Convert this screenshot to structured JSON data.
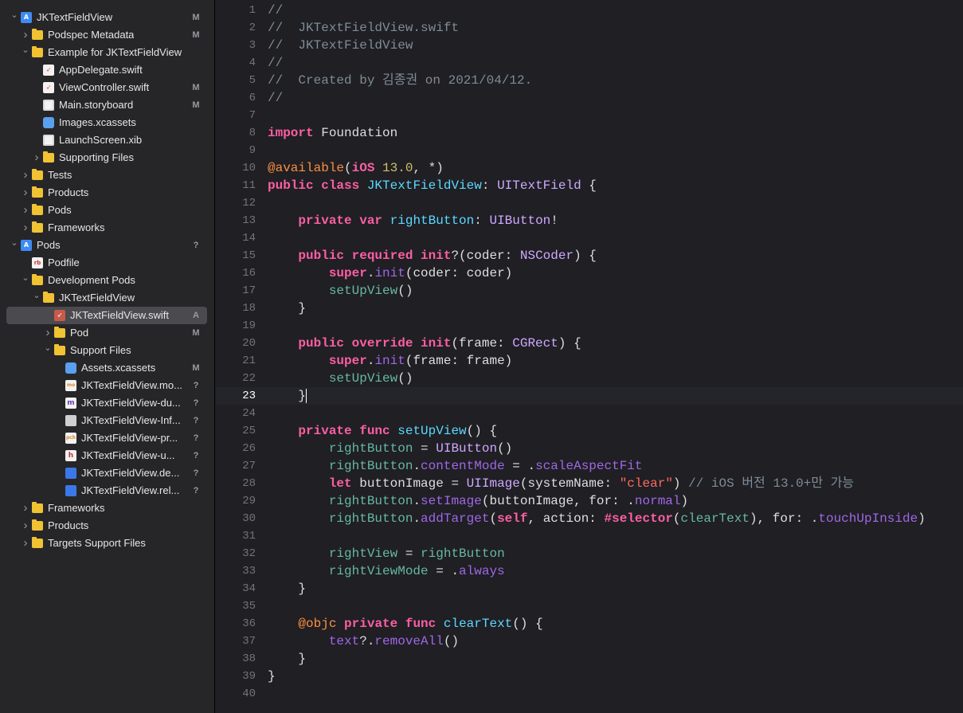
{
  "navigator": {
    "rows": [
      {
        "label": "JKTextFieldView",
        "status": "M",
        "indent": 0,
        "chevron": "down",
        "icon": "project",
        "iconGlyph": "A",
        "name": "project-jktextfieldview"
      },
      {
        "label": "Podspec Metadata",
        "status": "M",
        "indent": 1,
        "chevron": "right",
        "icon": "folder",
        "name": "folder-podspec-metadata"
      },
      {
        "label": "Example for JKTextFieldView",
        "status": "",
        "indent": 1,
        "chevron": "down",
        "icon": "folder",
        "name": "folder-example"
      },
      {
        "label": "AppDelegate.swift",
        "status": "",
        "indent": 2,
        "chevron": "",
        "icon": "swift",
        "iconGlyph": "➶",
        "name": "file-appdelegate"
      },
      {
        "label": "ViewController.swift",
        "status": "M",
        "indent": 2,
        "chevron": "",
        "icon": "swift",
        "iconGlyph": "➶",
        "name": "file-viewcontroller"
      },
      {
        "label": "Main.storyboard",
        "status": "M",
        "indent": 2,
        "chevron": "",
        "icon": "storyboard",
        "name": "file-main-storyboard"
      },
      {
        "label": "Images.xcassets",
        "status": "",
        "indent": 2,
        "chevron": "",
        "icon": "assets",
        "name": "file-images-xcassets"
      },
      {
        "label": "LaunchScreen.xib",
        "status": "",
        "indent": 2,
        "chevron": "",
        "icon": "xib",
        "name": "file-launchscreen-xib"
      },
      {
        "label": "Supporting Files",
        "status": "",
        "indent": 2,
        "chevron": "right",
        "icon": "folder",
        "name": "folder-supporting-files"
      },
      {
        "label": "Tests",
        "status": "",
        "indent": 1,
        "chevron": "right",
        "icon": "folder",
        "name": "folder-tests"
      },
      {
        "label": "Products",
        "status": "",
        "indent": 1,
        "chevron": "right",
        "icon": "folder",
        "name": "folder-products"
      },
      {
        "label": "Pods",
        "status": "",
        "indent": 1,
        "chevron": "right",
        "icon": "folder",
        "name": "folder-pods"
      },
      {
        "label": "Frameworks",
        "status": "",
        "indent": 1,
        "chevron": "right",
        "icon": "folder",
        "name": "folder-frameworks"
      },
      {
        "label": "Pods",
        "status": "?",
        "indent": 0,
        "chevron": "down",
        "icon": "project",
        "iconGlyph": "A",
        "name": "project-pods"
      },
      {
        "label": "Podfile",
        "status": "",
        "indent": 1,
        "chevron": "",
        "icon": "rb",
        "iconGlyph": "rb",
        "name": "file-podfile"
      },
      {
        "label": "Development Pods",
        "status": "",
        "indent": 1,
        "chevron": "down",
        "icon": "folder",
        "name": "folder-development-pods"
      },
      {
        "label": "JKTextFieldView",
        "status": "",
        "indent": 2,
        "chevron": "down",
        "icon": "folder",
        "name": "folder-jktextfieldview"
      },
      {
        "label": "JKTextFieldView.swift",
        "status": "A",
        "indent": 3,
        "chevron": "",
        "icon": "swift-sel",
        "iconGlyph": "➶",
        "selected": true,
        "name": "file-jktextfieldview-swift"
      },
      {
        "label": "Pod",
        "status": "M",
        "indent": 3,
        "chevron": "right",
        "icon": "folder",
        "name": "folder-pod"
      },
      {
        "label": "Support Files",
        "status": "",
        "indent": 3,
        "chevron": "down",
        "icon": "folder",
        "name": "folder-support-files"
      },
      {
        "label": "Assets.xcassets",
        "status": "M",
        "indent": 4,
        "chevron": "",
        "icon": "assets",
        "name": "file-assets-xcassets"
      },
      {
        "label": "JKTextFieldView.mo...",
        "status": "?",
        "indent": 4,
        "chevron": "",
        "icon": "pch",
        "iconGlyph": "mo",
        "name": "file-modulemap"
      },
      {
        "label": "JKTextFieldView-du...",
        "status": "?",
        "indent": 4,
        "chevron": "",
        "icon": "m",
        "iconGlyph": "m",
        "name": "file-dummy-m"
      },
      {
        "label": "JKTextFieldView-Inf...",
        "status": "?",
        "indent": 4,
        "chevron": "",
        "icon": "doc",
        "name": "file-info-plist"
      },
      {
        "label": "JKTextFieldView-pr...",
        "status": "?",
        "indent": 4,
        "chevron": "",
        "icon": "pch",
        "iconGlyph": "pch",
        "name": "file-prefix-pch"
      },
      {
        "label": "JKTextFieldView-u...",
        "status": "?",
        "indent": 4,
        "chevron": "",
        "icon": "h",
        "iconGlyph": "h",
        "name": "file-umbrella-h"
      },
      {
        "label": "JKTextFieldView.de...",
        "status": "?",
        "indent": 4,
        "chevron": "",
        "icon": "blue",
        "name": "file-debug-xcconfig"
      },
      {
        "label": "JKTextFieldView.rel...",
        "status": "?",
        "indent": 4,
        "chevron": "",
        "icon": "blue",
        "name": "file-release-xcconfig"
      },
      {
        "label": "Frameworks",
        "status": "",
        "indent": 1,
        "chevron": "right",
        "icon": "folder",
        "name": "folder-frameworks-2"
      },
      {
        "label": "Products",
        "status": "",
        "indent": 1,
        "chevron": "right",
        "icon": "folder",
        "name": "folder-products-2"
      },
      {
        "label": "Targets Support Files",
        "status": "",
        "indent": 1,
        "chevron": "right",
        "icon": "folder",
        "name": "folder-targets-support-files"
      }
    ]
  },
  "editor": {
    "active_line": 23,
    "lines": [
      [
        [
          "c",
          "//"
        ]
      ],
      [
        [
          "c",
          "//  JKTextFieldView.swift"
        ]
      ],
      [
        [
          "c",
          "//  JKTextFieldView"
        ]
      ],
      [
        [
          "c",
          "//"
        ]
      ],
      [
        [
          "c",
          "//  Created by 김종권 on 2021/04/12."
        ]
      ],
      [
        [
          "c",
          "//"
        ]
      ],
      [],
      [
        [
          "k",
          "import"
        ],
        [
          "p",
          " Foundation"
        ]
      ],
      [],
      [
        [
          "a",
          "@available"
        ],
        [
          "p",
          "("
        ],
        [
          "k",
          "iOS"
        ],
        [
          "p",
          " "
        ],
        [
          "n",
          "13.0"
        ],
        [
          "p",
          ", *)"
        ]
      ],
      [
        [
          "k",
          "public class"
        ],
        [
          "p",
          " "
        ],
        [
          "d",
          "JKTextFieldView"
        ],
        [
          "p",
          ": "
        ],
        [
          "t",
          "UITextField"
        ],
        [
          "p",
          " {"
        ]
      ],
      [],
      [
        [
          "p",
          "    "
        ],
        [
          "k",
          "private var"
        ],
        [
          "p",
          " "
        ],
        [
          "d",
          "rightButton"
        ],
        [
          "p",
          ": "
        ],
        [
          "t",
          "UIButton"
        ],
        [
          "p",
          "!"
        ]
      ],
      [],
      [
        [
          "p",
          "    "
        ],
        [
          "k",
          "public required init"
        ],
        [
          "p",
          "?(coder: "
        ],
        [
          "t",
          "NSCoder"
        ],
        [
          "p",
          ") {"
        ]
      ],
      [
        [
          "p",
          "        "
        ],
        [
          "k",
          "super"
        ],
        [
          "p",
          "."
        ],
        [
          "m",
          "init"
        ],
        [
          "p",
          "(coder: coder)"
        ]
      ],
      [
        [
          "p",
          "        "
        ],
        [
          "r",
          "setUpView"
        ],
        [
          "p",
          "()"
        ]
      ],
      [
        [
          "p",
          "    }"
        ]
      ],
      [],
      [
        [
          "p",
          "    "
        ],
        [
          "k",
          "public override init"
        ],
        [
          "p",
          "(frame: "
        ],
        [
          "t",
          "CGRect"
        ],
        [
          "p",
          ") {"
        ]
      ],
      [
        [
          "p",
          "        "
        ],
        [
          "k",
          "super"
        ],
        [
          "p",
          "."
        ],
        [
          "m",
          "init"
        ],
        [
          "p",
          "(frame: frame)"
        ]
      ],
      [
        [
          "p",
          "        "
        ],
        [
          "r",
          "setUpView"
        ],
        [
          "p",
          "()"
        ]
      ],
      [
        [
          "p",
          "    }"
        ]
      ],
      [],
      [
        [
          "p",
          "    "
        ],
        [
          "k",
          "private func"
        ],
        [
          "p",
          " "
        ],
        [
          "d",
          "setUpView"
        ],
        [
          "p",
          "() {"
        ]
      ],
      [
        [
          "p",
          "        "
        ],
        [
          "r",
          "rightButton"
        ],
        [
          "p",
          " = "
        ],
        [
          "t",
          "UIButton"
        ],
        [
          "p",
          "()"
        ]
      ],
      [
        [
          "p",
          "        "
        ],
        [
          "r",
          "rightButton"
        ],
        [
          "p",
          "."
        ],
        [
          "m",
          "contentMode"
        ],
        [
          "p",
          " = ."
        ],
        [
          "m",
          "scaleAspectFit"
        ]
      ],
      [
        [
          "p",
          "        "
        ],
        [
          "k",
          "let"
        ],
        [
          "p",
          " buttonImage = "
        ],
        [
          "t",
          "UIImage"
        ],
        [
          "p",
          "(systemName: "
        ],
        [
          "s",
          "\"clear\""
        ],
        [
          "p",
          ") "
        ],
        [
          "c",
          "// iOS 버전 13.0+만 가능"
        ]
      ],
      [
        [
          "p",
          "        "
        ],
        [
          "r",
          "rightButton"
        ],
        [
          "p",
          "."
        ],
        [
          "m",
          "setImage"
        ],
        [
          "p",
          "(buttonImage, for: ."
        ],
        [
          "m",
          "normal"
        ],
        [
          "p",
          ")"
        ]
      ],
      [
        [
          "p",
          "        "
        ],
        [
          "r",
          "rightButton"
        ],
        [
          "p",
          "."
        ],
        [
          "m",
          "addTarget"
        ],
        [
          "p",
          "("
        ],
        [
          "k",
          "self"
        ],
        [
          "p",
          ", action: "
        ],
        [
          "k",
          "#selector"
        ],
        [
          "p",
          "("
        ],
        [
          "r",
          "clearText"
        ],
        [
          "p",
          "), for: ."
        ],
        [
          "m",
          "touchUpInside"
        ],
        [
          "p",
          ")"
        ]
      ],
      [],
      [
        [
          "p",
          "        "
        ],
        [
          "r",
          "rightView"
        ],
        [
          "p",
          " = "
        ],
        [
          "r",
          "rightButton"
        ]
      ],
      [
        [
          "p",
          "        "
        ],
        [
          "r",
          "rightViewMode"
        ],
        [
          "p",
          " = ."
        ],
        [
          "m",
          "always"
        ]
      ],
      [
        [
          "p",
          "    }"
        ]
      ],
      [],
      [
        [
          "p",
          "    "
        ],
        [
          "a",
          "@objc"
        ],
        [
          "p",
          " "
        ],
        [
          "k",
          "private func"
        ],
        [
          "p",
          " "
        ],
        [
          "d",
          "clearText"
        ],
        [
          "p",
          "() {"
        ]
      ],
      [
        [
          "p",
          "        "
        ],
        [
          "m",
          "text"
        ],
        [
          "p",
          "?."
        ],
        [
          "m",
          "removeAll"
        ],
        [
          "p",
          "()"
        ]
      ],
      [
        [
          "p",
          "    }"
        ]
      ],
      [
        [
          "p",
          "}"
        ]
      ],
      []
    ]
  }
}
